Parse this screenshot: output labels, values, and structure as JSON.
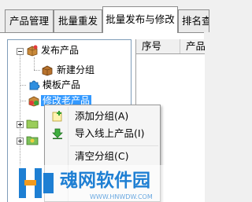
{
  "tabs": [
    {
      "label": "产品管理",
      "active": false
    },
    {
      "label": "批量重发",
      "active": false
    },
    {
      "label": "批量发布与修改",
      "active": true
    },
    {
      "label": "排名查",
      "active": false
    }
  ],
  "tree": {
    "root_label": "发布产品",
    "child_label": "新建分组",
    "template_label": "模板产品",
    "edit_label": "修改老产品"
  },
  "grid": {
    "columns": [
      "序号",
      "产品"
    ]
  },
  "context_menu": {
    "items": [
      {
        "label": "添加分组(A)",
        "icon": "add-group-icon"
      },
      {
        "label": "导入线上产品(I)",
        "icon": "import-download-icon"
      },
      {
        "label": "清空分组(C)",
        "icon": "clear-icon"
      }
    ]
  },
  "watermark": {
    "title": "魂网软件园",
    "url": "WWW.HNWDW.COM"
  },
  "colors": {
    "selection": "#3399ff",
    "watermark": "#1e7fd3"
  }
}
